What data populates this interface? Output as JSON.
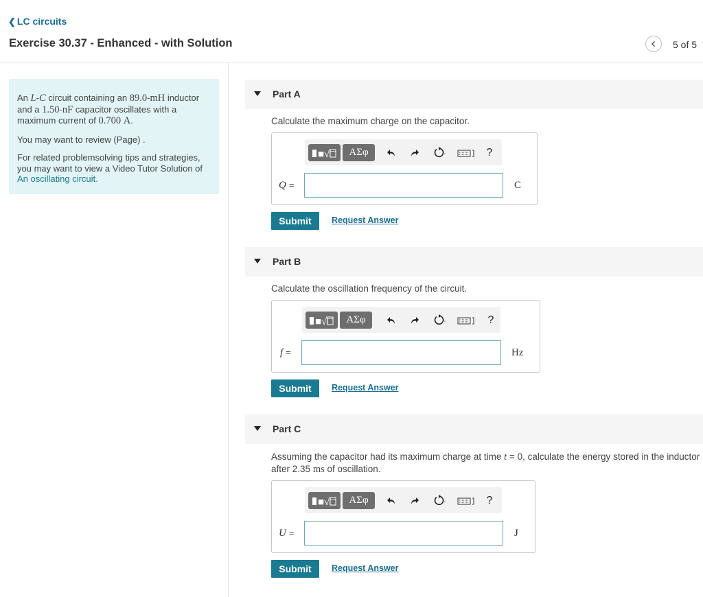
{
  "header": {
    "back_link": "LC circuits",
    "title": "Exercise 30.37 - Enhanced - with Solution",
    "pager": "5 of 5"
  },
  "problem": {
    "p1": {
      "pre": "An ",
      "L": "L",
      "dash": "-",
      "C": "C",
      "mid": " circuit containing an ",
      "inductance": "89.0",
      "inductance_sep": "-",
      "inductance_unit": "mH",
      "mid2": " inductor and a ",
      "capacitance": "1.50",
      "capacitance_sep": "-",
      "capacitance_unit": "nF",
      "mid3": " capacitor oscillates with a maximum current of ",
      "current": "0.700",
      "current_unit": "A",
      "end": "."
    },
    "review": "You may want to review (Page) .",
    "related": "For related problemsolving tips and strategies, you may want to view a Video Tutor Solution of",
    "related_link": "An oscillating circuit."
  },
  "toolbar": {
    "templates_label": "■√□",
    "greek_label": "ΑΣφ",
    "help": "?"
  },
  "parts": [
    {
      "label": "Part A",
      "question": "Calculate the maximum charge on the capacitor.",
      "variable": "Q",
      "equals": "=",
      "unit": "C",
      "input_value": "",
      "submit": "Submit",
      "request": "Request Answer"
    },
    {
      "label": "Part B",
      "question": "Calculate the oscillation frequency of the circuit.",
      "variable": "f",
      "equals": "=",
      "unit": "Hz",
      "input_value": "",
      "submit": "Submit",
      "request": "Request Answer"
    },
    {
      "label": "Part C",
      "question_pre": "Assuming the capacitor had its maximum charge at time ",
      "question_t": "t",
      "question_mid": " = 0, calculate the energy stored in the inductor after ",
      "question_time": "2.35",
      "question_time_unit": "ms",
      "question_end": " of oscillation.",
      "variable": "U",
      "equals": "=",
      "unit": "J",
      "input_value": "",
      "submit": "Submit",
      "request": "Request Answer"
    }
  ]
}
